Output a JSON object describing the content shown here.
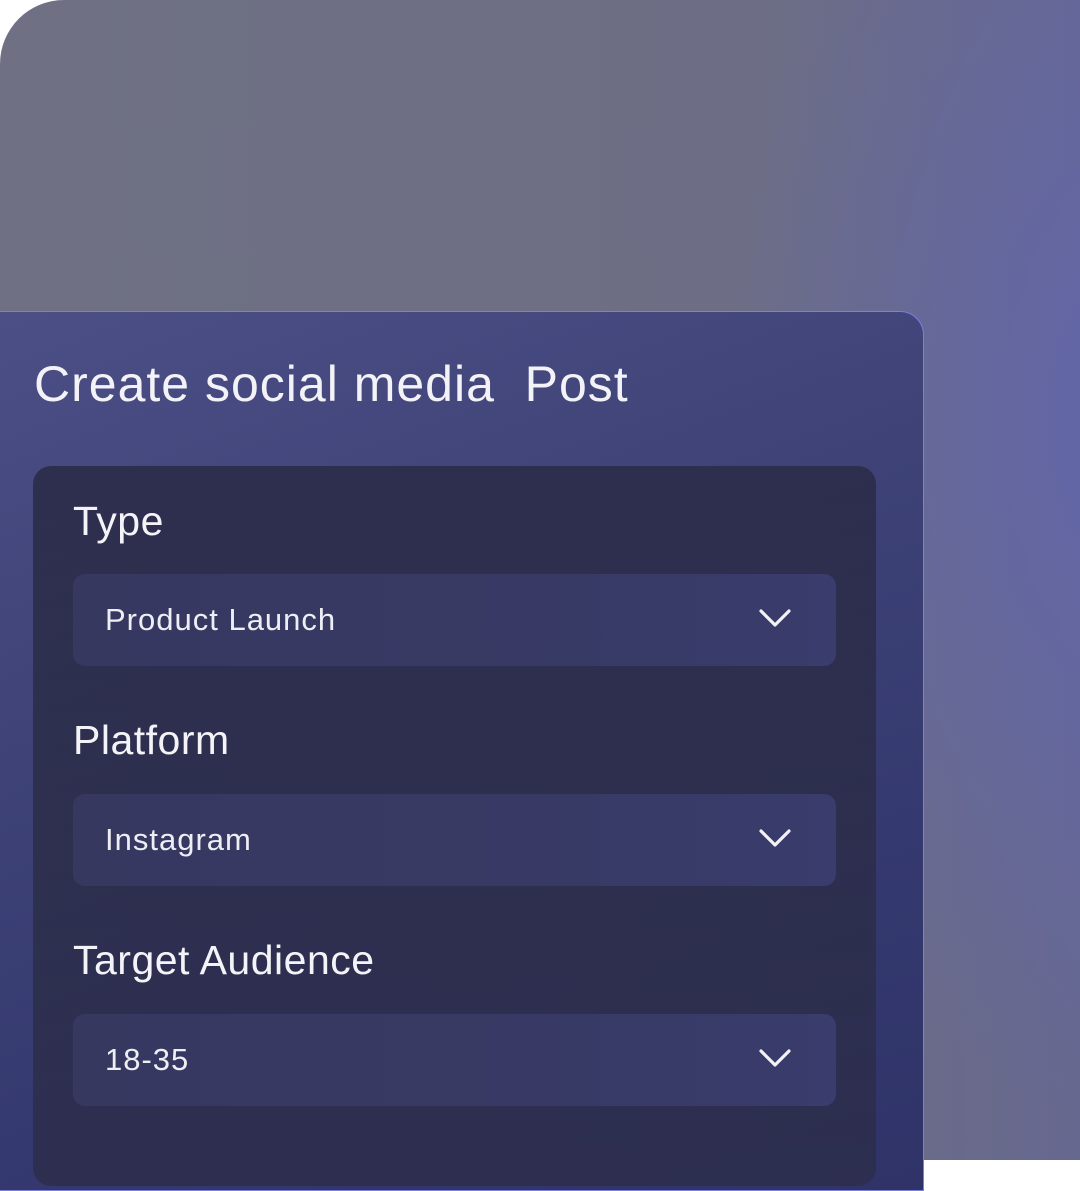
{
  "dialog": {
    "title": "Create social media  Post"
  },
  "fields": [
    {
      "label": "Type",
      "value": "Product Launch",
      "icon": "chevron-down-icon"
    },
    {
      "label": "Platform",
      "value": "Instagram",
      "icon": "chevron-down-icon"
    },
    {
      "label": "Target Audience",
      "value": "18-35",
      "icon": "chevron-down-icon"
    }
  ],
  "colors": {
    "accent_border": "#7a7fe0",
    "text": "#f4f4f8"
  }
}
